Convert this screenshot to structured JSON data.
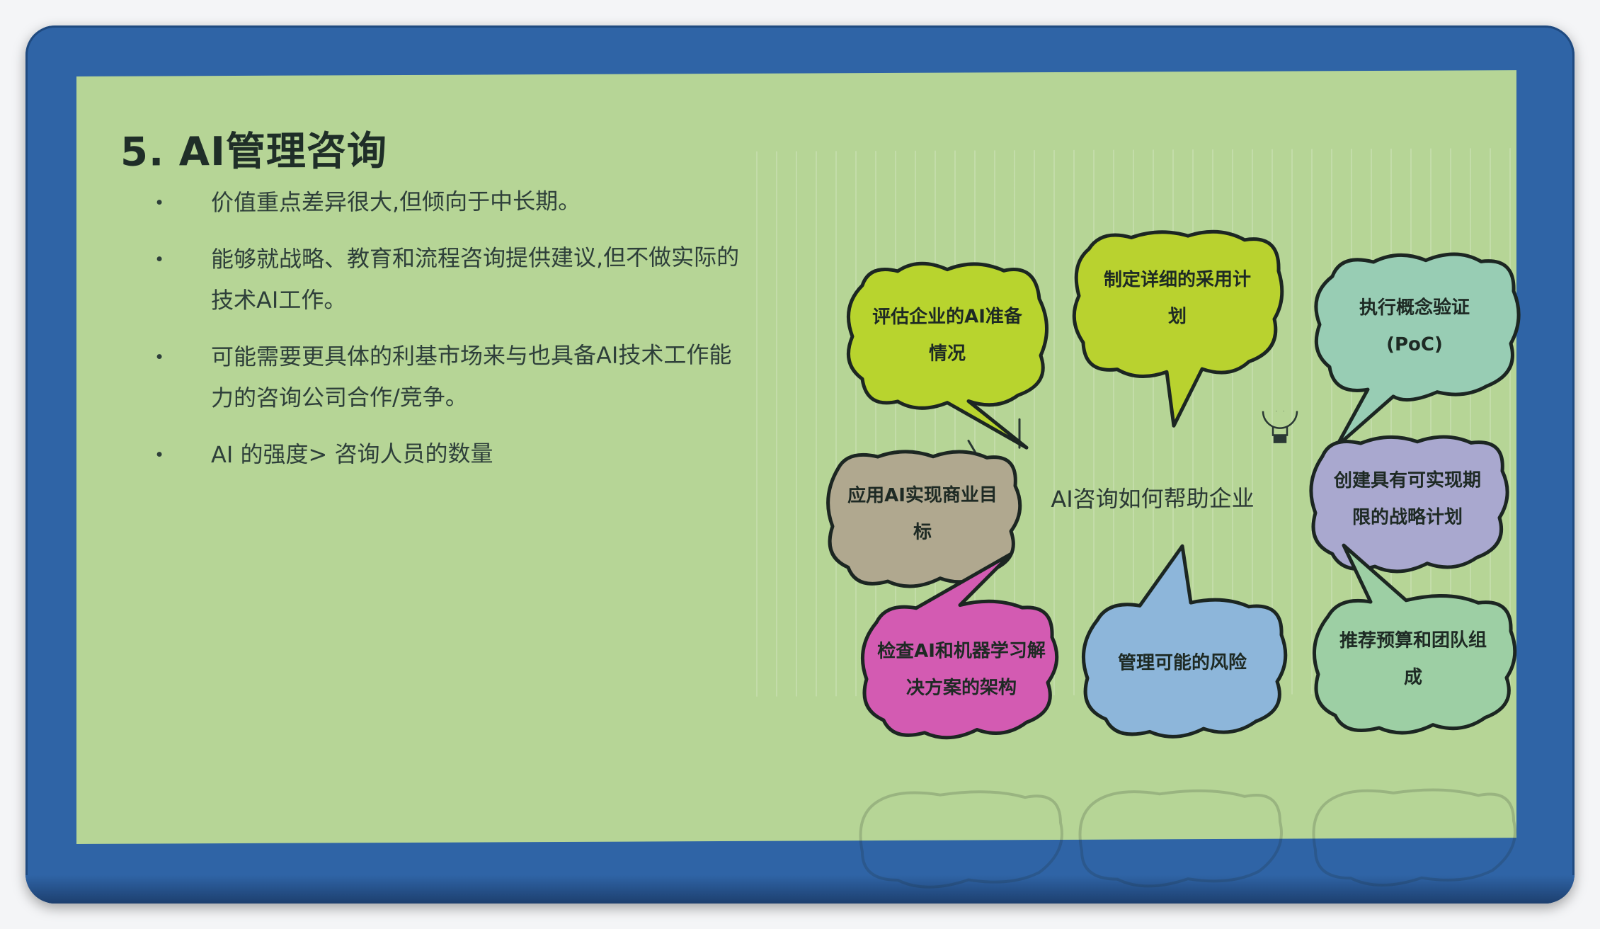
{
  "slide": {
    "title": "5. AI管理咨询",
    "bullets": [
      {
        "text": "价值重点差异很大,但倾向于中长期。"
      },
      {
        "text": "能够就战略、教育和流程咨询提供建议,但不做实际的技术AI工作。"
      },
      {
        "text": "可能需要更具体的利基市场来与也具备AI技术工作能力的咨询公司合作/竞争。"
      },
      {
        "text": "AI 的强度> 咨询人员的数量"
      }
    ],
    "bullet_marker": "•"
  },
  "diagram": {
    "center": "AI咨询如何帮助企业",
    "bubbles": [
      {
        "label": "评估企业的AI准备情况",
        "color": "#b8d42e"
      },
      {
        "label": "制定详细的采用计划",
        "color": "#b9d22f"
      },
      {
        "label": "执行概念验证(PoC)",
        "color": "#98cdb4"
      },
      {
        "label": "应用AI实现商业目标",
        "color": "#b0a88f"
      },
      {
        "label": "创建具有可实现期限的战略计划",
        "color": "#a9a8cf"
      },
      {
        "label": "检查AI和机器学习解决方案的架构",
        "color": "#d35bb2"
      },
      {
        "label": "管理可能的风险",
        "color": "#8db6da"
      },
      {
        "label": "推荐预算和团队组成",
        "color": "#9dcfa4"
      }
    ]
  },
  "colors": {
    "frame": "#2f64a6",
    "slide_bg": "#b6d596",
    "title": "#1f2e28"
  }
}
